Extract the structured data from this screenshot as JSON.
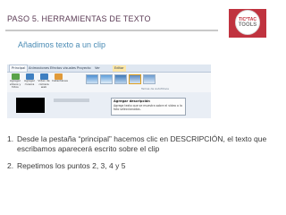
{
  "header": {
    "title": "PASO 5.   HERRAMIENTAS DE TEXTO",
    "logo_top": "TIC*TAC",
    "logo_bottom": "TOOLS"
  },
  "subtitle": "Añadimos texto a un clip",
  "screenshot": {
    "tabs": [
      "Principal",
      "Animaciones",
      "Efectos visuales",
      "Proyecto",
      "Ver",
      "Editar"
    ],
    "ribbon_buttons": [
      "Agregar vídeos y fotos",
      "Agregar música",
      "Vídeo de cámara web",
      "Instantánea"
    ],
    "ribbon_group_label": "Temas de AutoMovie",
    "tooltip_title": "Agregar descripción",
    "tooltip_body": "Agrega texto que se muestra sobre el vídeo o la foto seleccionados."
  },
  "steps": [
    {
      "number": "1.",
      "text": "Desde la pestaña “principal” hacemos clic en DESCRIPCIÓN, el texto que escribamos aparecerá escrito sobre el clip"
    },
    {
      "number": "2.",
      "text": "Repetimos los puntos 2, 3, 4 y 5"
    }
  ]
}
